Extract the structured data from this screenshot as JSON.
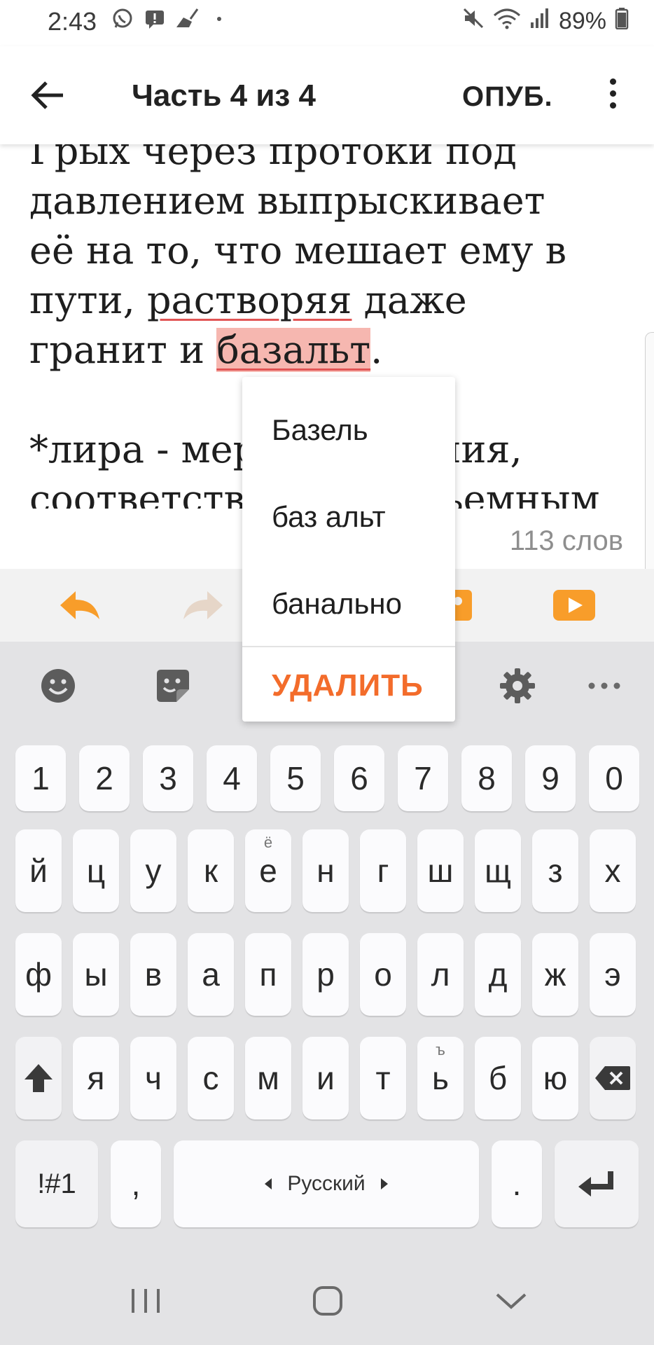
{
  "status_bar": {
    "time": "2:43",
    "battery": "89%"
  },
  "app_bar": {
    "title": "Часть 4 из 4",
    "publish_label": "ОПУБ."
  },
  "editor": {
    "lines": [
      {
        "text": "Грых через протоки под"
      },
      {
        "text": "давлением выпрыскивает"
      },
      {
        "text": "её на то, что мешает ему в"
      },
      {
        "before": "пути, ",
        "misspelled": "растворяя",
        "after": " даже"
      },
      {
        "before": "гранит и ",
        "selected": "базальт",
        "after": "."
      },
      {
        "text": ""
      },
      {
        "text": "*лира - мера измерения,"
      },
      {
        "text": "соответствующая объемным"
      }
    ],
    "word_count": "113 слов"
  },
  "suggestion_popup": {
    "suggestions": [
      "Базель",
      "баз альт",
      "банально"
    ],
    "delete_label": "УДАЛИТЬ"
  },
  "colors": {
    "accent": "#f36c2b",
    "toolbar_icon": "#f89d2a",
    "selection": "#f6b7b0",
    "misspell_underline": "#e15555"
  },
  "keyboard": {
    "number_row": [
      "1",
      "2",
      "3",
      "4",
      "5",
      "6",
      "7",
      "8",
      "9",
      "0"
    ],
    "row1": [
      "й",
      "ц",
      "у",
      "к",
      "е",
      "н",
      "г",
      "ш",
      "щ",
      "з",
      "х"
    ],
    "row1_hint_e": "ё",
    "row2": [
      "ф",
      "ы",
      "в",
      "а",
      "п",
      "р",
      "о",
      "л",
      "д",
      "ж",
      "э"
    ],
    "row3": [
      "я",
      "ч",
      "с",
      "м",
      "и",
      "т",
      "ь",
      "б",
      "ю"
    ],
    "row3_hint_soft": "ъ",
    "symbols_label": "!#1",
    "comma_label": ",",
    "space_label": "Русский",
    "period_label": "."
  }
}
